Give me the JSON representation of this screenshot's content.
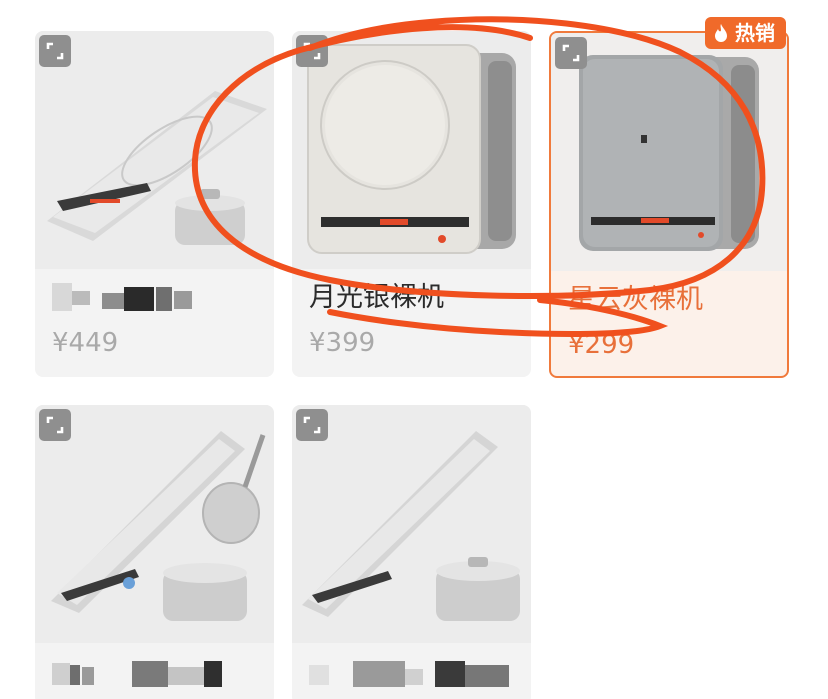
{
  "products": [
    {
      "id": "p1",
      "title": "",
      "price": "¥449",
      "selected": false
    },
    {
      "id": "p2",
      "title": "月光银裸机",
      "price": "¥399",
      "selected": false
    },
    {
      "id": "p3",
      "title": "星云灰裸机",
      "price": "¥299",
      "selected": true
    },
    {
      "id": "p4",
      "title": "",
      "price": "",
      "selected": false
    },
    {
      "id": "p5",
      "title": "",
      "price": "",
      "selected": false
    }
  ],
  "badge": {
    "label": "热销",
    "icon": "flame-icon"
  },
  "icons": {
    "expand": "expand-icon"
  },
  "colors": {
    "accent": "#f06a2a",
    "annotation": "#f0501e",
    "card_bg": "#f3f3f3"
  }
}
